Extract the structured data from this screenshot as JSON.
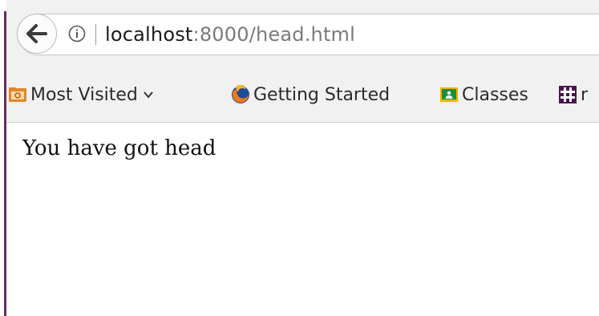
{
  "browser": {
    "url": {
      "host": "localhost",
      "rest": ":8000/head.html"
    },
    "bookmarks": [
      {
        "label": "Most Visited",
        "icon": "folder-icon",
        "dropdown": true
      },
      {
        "label": "Getting Started",
        "icon": "firefox-icon",
        "dropdown": false
      },
      {
        "label": "Classes",
        "icon": "google-classroom-icon",
        "dropdown": false
      },
      {
        "label": "r",
        "icon": "slack-icon",
        "dropdown": false
      }
    ]
  },
  "page": {
    "body_text": "You have got head"
  },
  "colors": {
    "window_edge": "#6a2a5c",
    "toolbar_bg": "#f1f1f1",
    "folder_orange": "#e0872a",
    "classroom_yellow": "#f0b400",
    "slack_purple": "#4a154b"
  }
}
